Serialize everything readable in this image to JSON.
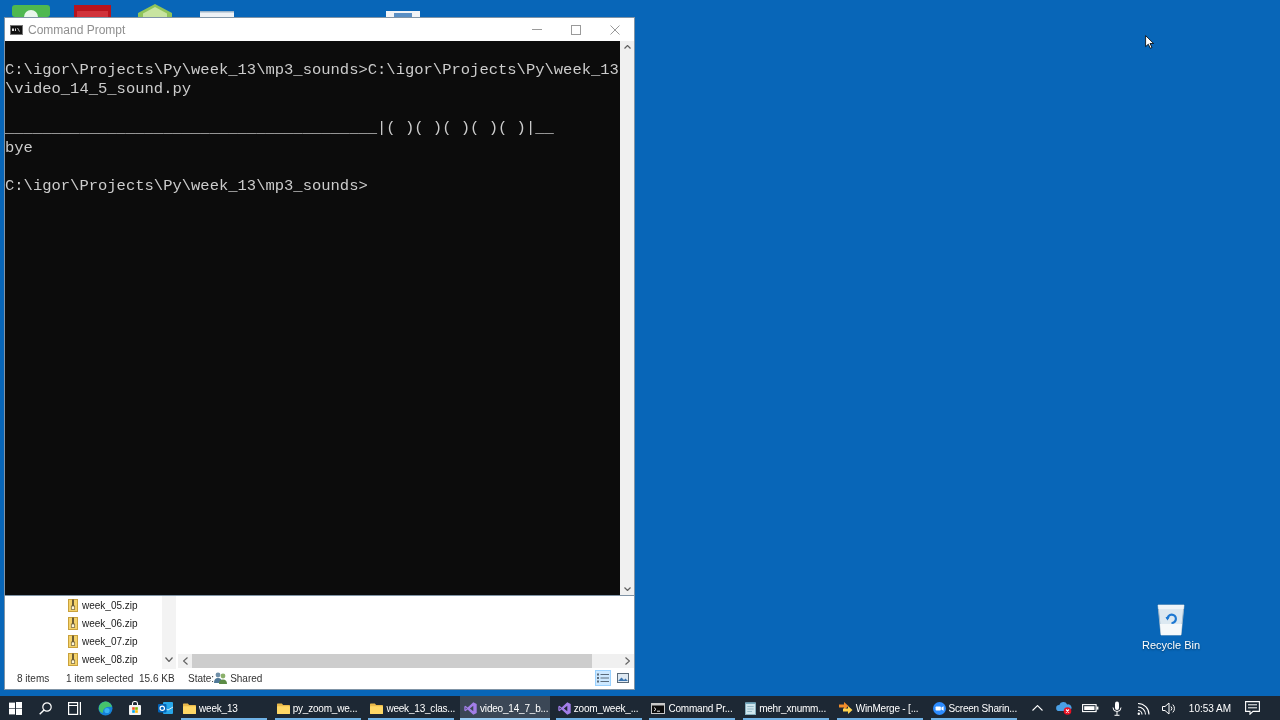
{
  "desktop": {
    "icons": [
      {
        "label": "Recycle Bin"
      }
    ]
  },
  "command_prompt": {
    "title": "Command Prompt",
    "blocks": [
      [
        "C:\\igor\\Projects\\Py\\week_13\\mp3_sounds>C:\\igor\\Projects\\Py\\week_13\\video_14_5_sound.py"
      ],
      [
        "________________________________________|( )( )( )( )( )|__",
        "bye"
      ],
      [
        "C:\\igor\\Projects\\Py\\week_13\\mp3_sounds>"
      ]
    ]
  },
  "file_explorer": {
    "tree_items": [
      {
        "label": "week_05.zip"
      },
      {
        "label": "week_06.zip"
      },
      {
        "label": "week_07.zip"
      },
      {
        "label": "week_08.zip"
      }
    ],
    "status_bar": {
      "item_count": "8 items",
      "selection": "1 item selected",
      "size": "15.6 KB",
      "state_label": "State:",
      "state_value": "Shared"
    },
    "view_buttons": [
      {
        "kind": "details",
        "selected": true
      },
      {
        "kind": "large_icons",
        "selected": false
      }
    ]
  },
  "taskbar": {
    "pinned": [
      {
        "kind": "start"
      },
      {
        "kind": "search"
      },
      {
        "kind": "task_view"
      },
      {
        "kind": "browser"
      },
      {
        "kind": "store"
      },
      {
        "kind": "mail"
      }
    ],
    "windows": [
      {
        "label": "week_13",
        "kind": "folder",
        "selected": false
      },
      {
        "label": "py_zoom_we...",
        "kind": "folder",
        "selected": false
      },
      {
        "label": "week_13_clas...",
        "kind": "folder",
        "selected": false
      },
      {
        "label": "video_14_7_b...",
        "kind": "ide",
        "selected": true
      },
      {
        "label": "zoom_week_...",
        "kind": "ide",
        "selected": false
      },
      {
        "label": "Command Pr...",
        "kind": "terminal",
        "selected": false
      },
      {
        "label": "mehr_xnumm...",
        "kind": "document",
        "selected": false
      },
      {
        "label": "WinMerge - [...",
        "kind": "merge",
        "selected": false
      },
      {
        "label": "Screen Sharin...",
        "kind": "meeting",
        "selected": false
      }
    ],
    "tray": [
      {
        "kind": "overflow"
      },
      {
        "kind": "cloud_error"
      },
      {
        "kind": "battery"
      },
      {
        "kind": "microphone"
      },
      {
        "kind": "network"
      },
      {
        "kind": "volume"
      }
    ],
    "clock": "10:53 AM"
  }
}
